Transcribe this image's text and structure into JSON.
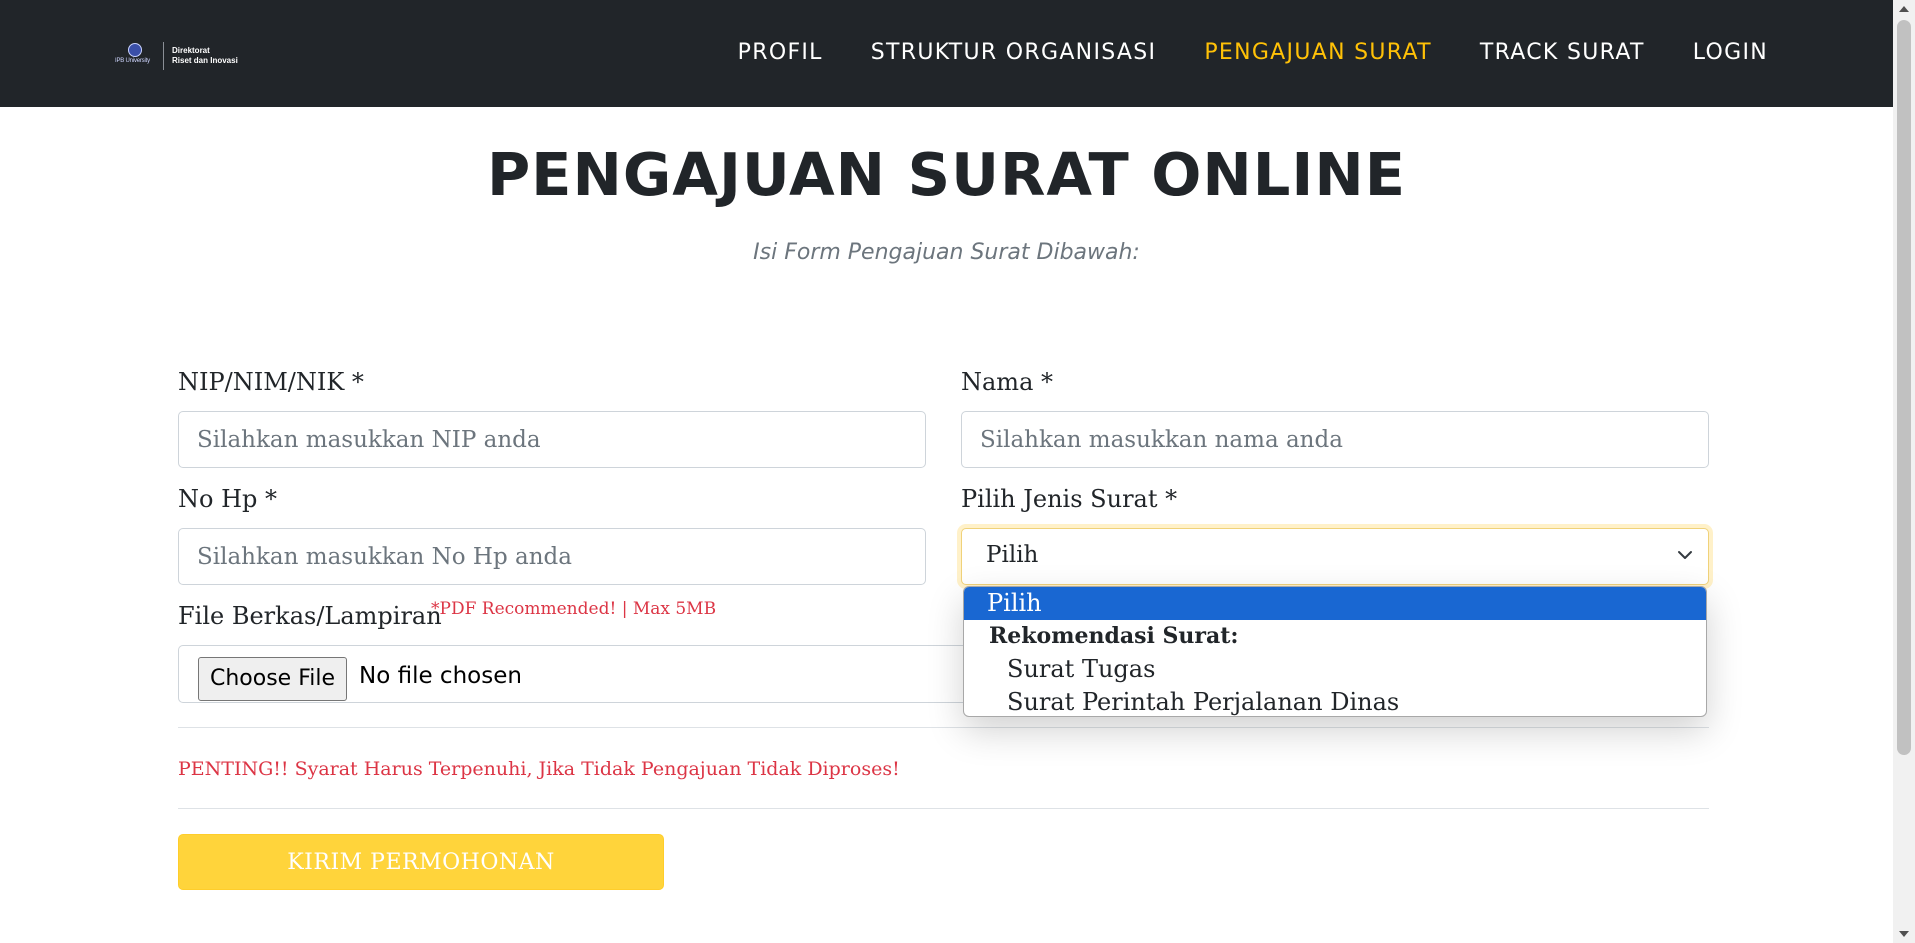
{
  "navbar": {
    "brand": {
      "logo_small_text": "IPB University",
      "line1": "Direktorat",
      "line2": "Riset dan Inovasi"
    },
    "links": [
      {
        "label": "PROFIL",
        "active": false
      },
      {
        "label": "STRUKTUR ORGANISASI",
        "active": false
      },
      {
        "label": "PENGAJUAN SURAT",
        "active": true
      },
      {
        "label": "TRACK SURAT",
        "active": false
      },
      {
        "label": "LOGIN",
        "active": false
      }
    ],
    "colors": {
      "background": "#212529",
      "active": "#ffc107",
      "text": "#ffffff"
    }
  },
  "header": {
    "title": "PENGAJUAN SURAT ONLINE",
    "subtitle": "Isi Form Pengajuan Surat Dibawah:"
  },
  "form": {
    "nip": {
      "label": "NIP/NIM/NIK *",
      "value": "",
      "placeholder": "Silahkan masukkan NIP anda"
    },
    "nama": {
      "label": "Nama *",
      "value": "",
      "placeholder": "Silahkan masukkan nama anda"
    },
    "nohp": {
      "label": "No Hp *",
      "value": "",
      "placeholder": "Silahkan masukkan No Hp anda"
    },
    "jenis": {
      "label": "Pilih Jenis Surat *",
      "selected": "Pilih",
      "options": [
        {
          "label": "Pilih",
          "kind": "option",
          "selected": true
        },
        {
          "label": "Rekomendasi Surat:",
          "kind": "group"
        },
        {
          "label": "Surat Tugas",
          "kind": "option"
        },
        {
          "label": "Surat Perintah Perjalanan Dinas",
          "kind": "option"
        }
      ]
    },
    "file": {
      "label": "File Berkas/Lampiran",
      "hint": "*PDF Recommended! | Max 5MB",
      "button": "Choose File",
      "status": "No file chosen"
    },
    "warning": "PENTING!! Syarat Harus Terpenuhi, Jika Tidak Pengajuan Tidak Diproses!",
    "submit": "KIRIM PERMOHONAN"
  },
  "colors": {
    "accent": "#ffd43b",
    "danger": "#dc3545",
    "highlight": "#1967d2"
  }
}
